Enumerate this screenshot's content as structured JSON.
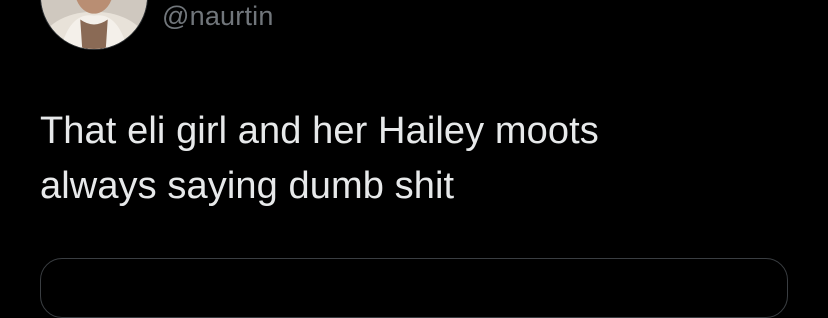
{
  "tweet": {
    "handle": "@naurtin",
    "text": "That eli girl and her Hailey moots\nalways saying dumb shit",
    "avatar_icon": "profile-photo"
  },
  "theme": {
    "background": "#000000",
    "text_color": "#e7e9ea",
    "secondary_text": "#71767b",
    "border": "#3a3e42"
  }
}
